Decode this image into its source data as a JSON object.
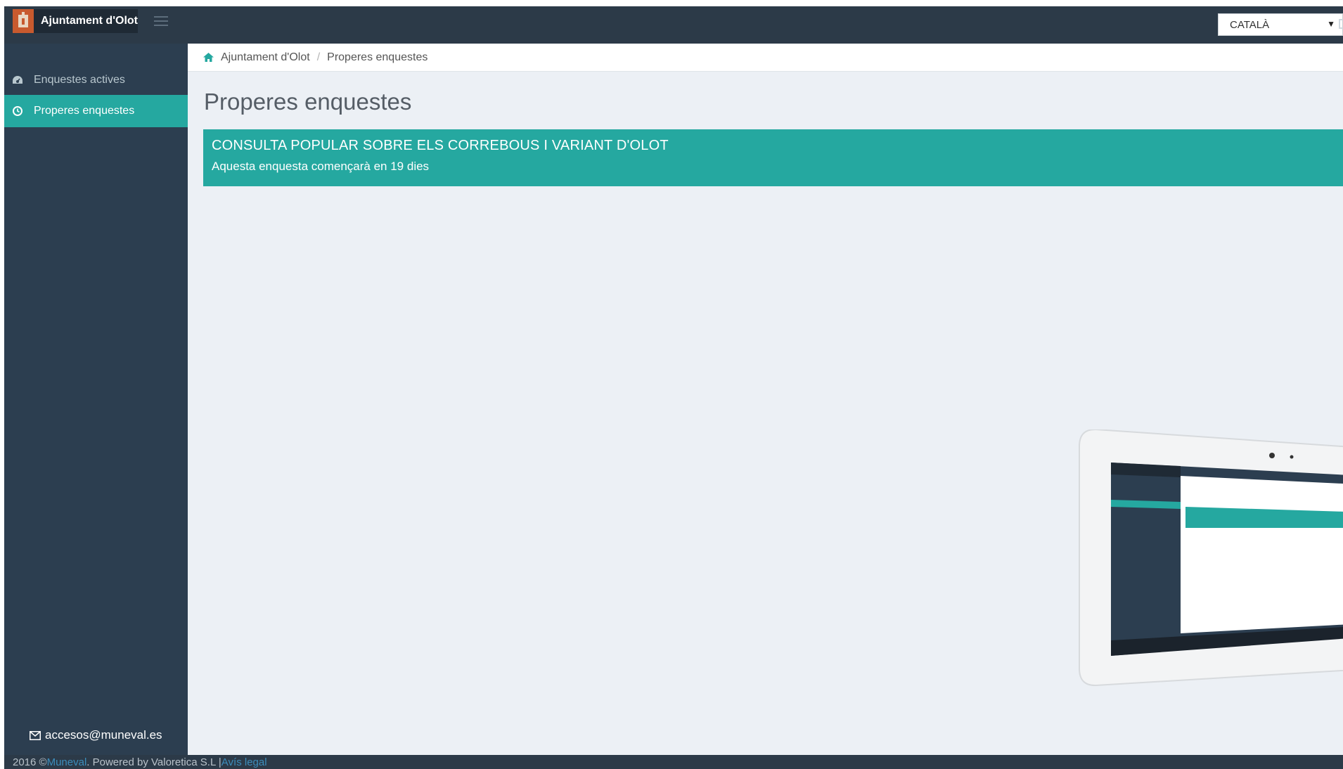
{
  "header": {
    "brand_name": "Ajuntament d'Olot",
    "language": "CATALÀ"
  },
  "sidebar": {
    "items": [
      {
        "label": "Enquestes actives",
        "icon": "dashboard-icon",
        "active": false
      },
      {
        "label": "Properes enquestes",
        "icon": "clock-icon",
        "active": true
      }
    ],
    "email": "accesos@muneval.es"
  },
  "breadcrumb": {
    "home": "Ajuntament d'Olot",
    "current": "Properes enquestes"
  },
  "main": {
    "title": "Properes enquestes",
    "survey": {
      "title": "CONSULTA POPULAR SOBRE ELS CORREBOUS I VARIANT D'OLOT",
      "subtitle": "Aquesta enquesta començarà en 19 dies"
    }
  },
  "footer": {
    "copyright": "2016 © ",
    "brand_link": "Muneval",
    "powered": ". Powered by Valoretica S.L | ",
    "legal_link": "Avís legal"
  },
  "colors": {
    "accent": "#25a8a0",
    "sidebar": "#2c3e50",
    "topbar": "#2c3a48",
    "link": "#3c8dbc"
  }
}
